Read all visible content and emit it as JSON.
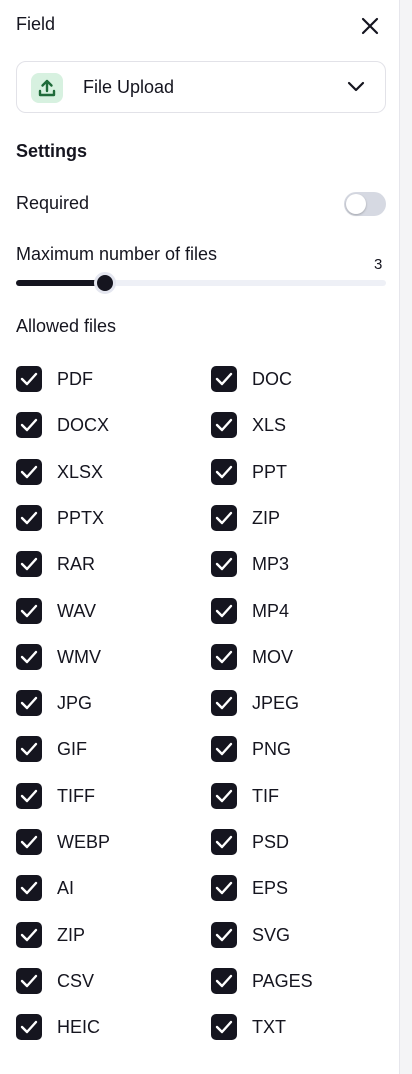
{
  "header": {
    "title": "Field",
    "close_icon": "close-icon"
  },
  "field_type": {
    "label": "File Upload",
    "icon": "upload-icon",
    "icon_bg": "#d7f1e0",
    "icon_color": "#1f6b3a"
  },
  "settings": {
    "title": "Settings",
    "required": {
      "label": "Required",
      "checked": false
    },
    "max_files": {
      "label": "Maximum number of files",
      "value": "3",
      "fraction": 0.24
    },
    "allowed_label": "Allowed files",
    "file_types": [
      "PDF",
      "DOC",
      "DOCX",
      "XLS",
      "XLSX",
      "PPT",
      "PPTX",
      "ZIP",
      "RAR",
      "MP3",
      "WAV",
      "MP4",
      "WMV",
      "MOV",
      "JPG",
      "JPEG",
      "GIF",
      "PNG",
      "TIFF",
      "TIF",
      "WEBP",
      "PSD",
      "AI",
      "EPS",
      "ZIP",
      "SVG",
      "CSV",
      "PAGES",
      "HEIC",
      "TXT"
    ]
  },
  "colors": {
    "accent": "#15151f",
    "toggle_off": "#d6d9e2",
    "track": "#eef0f6"
  }
}
